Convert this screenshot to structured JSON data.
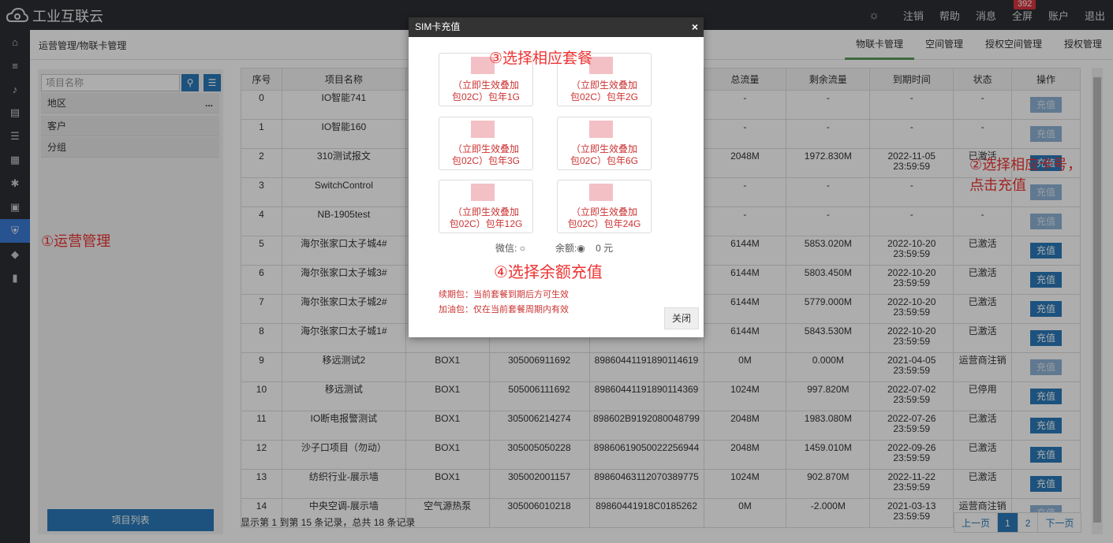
{
  "topbar": {
    "logo": "工业互联云",
    "nav": [
      "注销",
      "帮助",
      "消息",
      "全屏",
      "账户",
      "退出"
    ],
    "badge": "392"
  },
  "breadcrumb": "运营管理/物联卡管理",
  "tabs": [
    "物联卡管理",
    "空间管理",
    "授权空间管理",
    "授权管理"
  ],
  "side": {
    "search_placeholder": "项目名称",
    "items": [
      "地区",
      "客户",
      "分组"
    ],
    "more": "...",
    "project_list": "项目列表"
  },
  "annotations": {
    "a1": "①运营管理",
    "a2_line1": "②选择相应卡号，",
    "a2_line2": "点击充值",
    "a3": "③选择相应套餐",
    "a4": "④选择余额充值"
  },
  "table": {
    "headers": [
      "序号",
      "项目名称",
      "",
      "",
      "",
      "总流量",
      "剩余流量",
      "到期时间",
      "状态",
      "操作"
    ],
    "action_label": "充值",
    "rows": [
      {
        "no": "0",
        "name": "IO智能741",
        "type": "",
        "sim": "",
        "iccid": "",
        "total": "-",
        "remain": "-",
        "exp1": "-",
        "exp2": "",
        "status": "-",
        "enabled": false
      },
      {
        "no": "1",
        "name": "IO智能160",
        "type": "",
        "sim": "",
        "iccid": "",
        "total": "-",
        "remain": "-",
        "exp1": "-",
        "exp2": "",
        "status": "-",
        "enabled": false
      },
      {
        "no": "2",
        "name": "310测试报文",
        "type": "",
        "sim": "",
        "iccid": "",
        "total": "2048M",
        "remain": "1972.830M",
        "exp1": "2022-11-05",
        "exp2": "23:59:59",
        "status": "已激活",
        "enabled": true
      },
      {
        "no": "3",
        "name": "SwitchControl",
        "type": "",
        "sim": "",
        "iccid": "",
        "total": "-",
        "remain": "-",
        "exp1": "-",
        "exp2": "",
        "status": "-",
        "enabled": false
      },
      {
        "no": "4",
        "name": "NB-1905test",
        "type": "",
        "sim": "",
        "iccid": "",
        "total": "-",
        "remain": "-",
        "exp1": "-",
        "exp2": "",
        "status": "-",
        "enabled": false
      },
      {
        "no": "5",
        "name": "海尔张家口太子城4#",
        "type": "",
        "sim": "",
        "iccid": "",
        "total": "6144M",
        "remain": "5853.020M",
        "exp1": "2022-10-20",
        "exp2": "23:59:59",
        "status": "已激活",
        "enabled": true
      },
      {
        "no": "6",
        "name": "海尔张家口太子城3#",
        "type": "",
        "sim": "",
        "iccid": "",
        "total": "6144M",
        "remain": "5803.450M",
        "exp1": "2022-10-20",
        "exp2": "23:59:59",
        "status": "已激活",
        "enabled": true
      },
      {
        "no": "7",
        "name": "海尔张家口太子城2#",
        "type": "",
        "sim": "",
        "iccid": "",
        "total": "6144M",
        "remain": "5779.000M",
        "exp1": "2022-10-20",
        "exp2": "23:59:59",
        "status": "已激活",
        "enabled": true
      },
      {
        "no": "8",
        "name": "海尔张家口太子城1#",
        "type": "",
        "sim": "",
        "iccid": "",
        "total": "6144M",
        "remain": "5843.530M",
        "exp1": "2022-10-20",
        "exp2": "23:59:59",
        "status": "已激活",
        "enabled": true
      },
      {
        "no": "9",
        "name": "移远测试2",
        "type": "BOX1",
        "sim": "305006911692",
        "iccid": "89860441191890114619",
        "total": "0M",
        "remain": "0.000M",
        "exp1": "2021-04-05",
        "exp2": "23:59:59",
        "status": "运营商注销",
        "enabled": false
      },
      {
        "no": "10",
        "name": "移远测试",
        "type": "BOX1",
        "sim": "505006111692",
        "iccid": "89860441191890114369",
        "total": "1024M",
        "remain": "997.820M",
        "exp1": "2022-07-02",
        "exp2": "23:59:59",
        "status": "已停用",
        "enabled": true
      },
      {
        "no": "11",
        "name": "IO断电报警测试",
        "type": "BOX1",
        "sim": "305006214274",
        "iccid": "898602B9192080048799",
        "total": "2048M",
        "remain": "1983.080M",
        "exp1": "2022-07-26",
        "exp2": "23:59:59",
        "status": "已激活",
        "enabled": true
      },
      {
        "no": "12",
        "name": "沙子口项目（勿动）",
        "type": "BOX1",
        "sim": "305005050228",
        "iccid": "89860619050022256944",
        "total": "2048M",
        "remain": "1459.010M",
        "exp1": "2022-09-26",
        "exp2": "23:59:59",
        "status": "已激活",
        "enabled": true
      },
      {
        "no": "13",
        "name": "纺织行业-展示墙",
        "type": "BOX1",
        "sim": "305002001157",
        "iccid": "89860463112070389775",
        "total": "1024M",
        "remain": "902.870M",
        "exp1": "2022-11-22",
        "exp2": "23:59:59",
        "status": "已激活",
        "enabled": true
      },
      {
        "no": "14",
        "name": "中央空调-展示墙",
        "type": "空气源热泵",
        "sim": "305006010218",
        "iccid": "89860441918C0185262",
        "total": "0M",
        "remain": "-2.000M",
        "exp1": "2021-03-13",
        "exp2": "23:59:59",
        "status": "运营商注销",
        "enabled": false
      }
    ]
  },
  "footer": "显示第 1 到第 15 条记录，总共 18 条记录",
  "pager": [
    "上一页",
    "1",
    "2",
    "下一页"
  ],
  "modal": {
    "title": "SIM卡充值",
    "close_x": "×",
    "packages": [
      {
        "l1": "（立即生效叠加",
        "l2": "包02C）包年1G"
      },
      {
        "l1": "（立即生效叠加",
        "l2": "包02C）包年2G"
      },
      {
        "l1": "（立即生效叠加",
        "l2": "包02C）包年3G"
      },
      {
        "l1": "（立即生效叠加",
        "l2": "包02C）包年6G"
      },
      {
        "l1": "（立即生效叠加",
        "l2": "包02C）包年12G"
      },
      {
        "l1": "（立即生效叠加",
        "l2": "包02C）包年24G"
      }
    ],
    "wechat": "微信:",
    "balance": "余额:",
    "amount": "0 元",
    "note1": "续期包：当前套餐到期后方可生效",
    "note2": "加油包：仅在当前套餐周期内有效",
    "close_btn": "关闭"
  }
}
